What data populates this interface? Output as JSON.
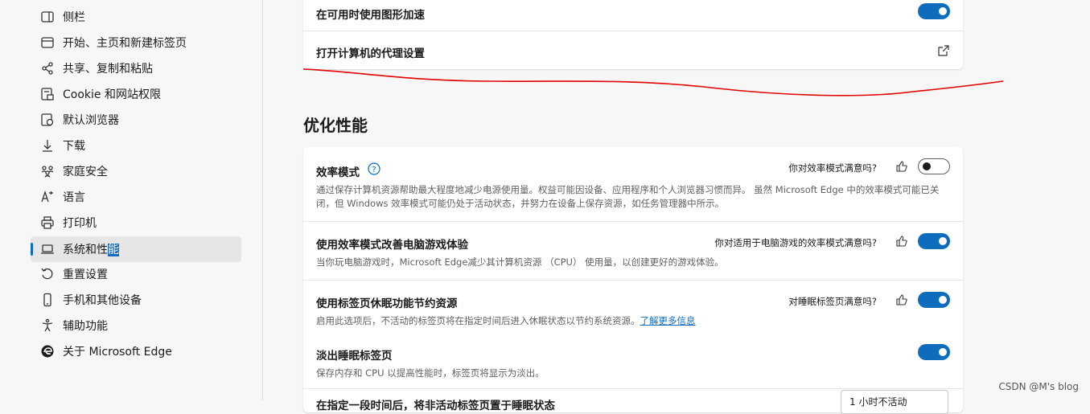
{
  "sidebar": {
    "items": [
      {
        "label": "侧栏",
        "icon": "sidebar-icon"
      },
      {
        "label": "开始、主页和新建标签页",
        "icon": "home-icon"
      },
      {
        "label": "共享、复制和粘贴",
        "icon": "share-icon"
      },
      {
        "label": "Cookie 和网站权限",
        "icon": "site-permissions-icon"
      },
      {
        "label": "默认浏览器",
        "icon": "browser-icon"
      },
      {
        "label": "下载",
        "icon": "download-icon"
      },
      {
        "label": "家庭安全",
        "icon": "family-icon"
      },
      {
        "label": "语言",
        "icon": "language-icon"
      },
      {
        "label": "打印机",
        "icon": "printer-icon"
      },
      {
        "label_main": "系统和性",
        "label_highlight": "能",
        "icon": "laptop-icon",
        "active": true
      },
      {
        "label": "重置设置",
        "icon": "reset-icon"
      },
      {
        "label": "手机和其他设备",
        "icon": "phone-icon"
      },
      {
        "label": "辅助功能",
        "icon": "accessibility-icon"
      },
      {
        "label": "关于 Microsoft Edge",
        "icon": "edge-logo-icon"
      }
    ]
  },
  "system_card": {
    "graphics_accel": {
      "title": "在可用时使用图形加速",
      "enabled": true
    },
    "proxy": {
      "title": "打开计算机的代理设置",
      "icon": "external-link-icon"
    }
  },
  "performance": {
    "section_title": "优化性能",
    "efficiency_mode": {
      "title": "效率模式",
      "feedback_question": "你对效率模式满意吗?",
      "desc": "通过保存计算机资源帮助最大程度地减少电源使用量。权益可能因设备、应用程序和个人浏览器习惯而异。 虽然 Microsoft Edge 中的效率模式可能已关闭，但 Windows 效率模式可能仍处于活动状态，并努力在设备上保存资源，如任务管理器中所示。",
      "enabled": false
    },
    "gaming": {
      "title": "使用效率模式改善电脑游戏体验",
      "feedback_question": "你对适用于电脑游戏的效率模式满意吗?",
      "desc": "当你玩电脑游戏时，Microsoft Edge减少其计算机资源 （CPU） 使用量，以创建更好的游戏体验。",
      "enabled": true
    },
    "sleeping_tabs": {
      "title": "使用标签页休眠功能节约资源",
      "feedback_question": "对睡眠标签页满意吗?",
      "desc": "启用此选项后，不活动的标签页将在指定时间后进入休眠状态以节约系统资源。",
      "link": "了解更多信息",
      "enabled": true
    },
    "fade_tabs": {
      "title": "淡出睡眠标签页",
      "desc": "保存内存和 CPU 以提高性能时，标签页将显示为淡出。",
      "enabled": true
    },
    "partial": {
      "title": "在指定一段时间后，将非活动标签页置于睡眠状态",
      "dropdown_value": "1 小时不活动"
    }
  },
  "annotation_color": "#e00000",
  "watermark": "CSDN @M's blog"
}
